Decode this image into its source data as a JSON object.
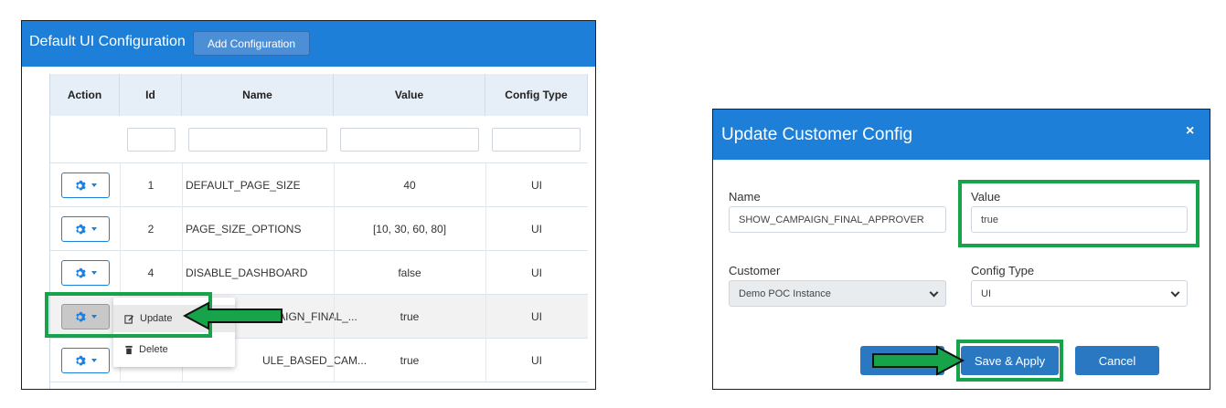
{
  "left": {
    "title": "Default UI Configuration",
    "add_button": "Add Configuration",
    "columns": [
      "Action",
      "Id",
      "Name",
      "Value",
      "Config Type"
    ],
    "rows": [
      {
        "id": "1",
        "name": "DEFAULT_PAGE_SIZE",
        "value": "40",
        "type": "UI"
      },
      {
        "id": "2",
        "name": "PAGE_SIZE_OPTIONS",
        "value": "[10, 30, 60, 80]",
        "type": "UI"
      },
      {
        "id": "4",
        "name": "DISABLE_DASHBOARD",
        "value": "false",
        "type": "UI"
      },
      {
        "id": "",
        "name": "MPAIGN_FINAL_...",
        "value": "true",
        "type": "UI"
      },
      {
        "id": "",
        "name": "ULE_BASED_CAM...",
        "value": "true",
        "type": "UI"
      }
    ],
    "dropdown": {
      "update": "Update",
      "delete": "Delete"
    }
  },
  "right": {
    "title": "Update Customer Config",
    "close": "×",
    "name_label": "Name",
    "name_value": "SHOW_CAMPAIGN_FINAL_APPROVER",
    "value_label": "Value",
    "value_value": "true",
    "customer_label": "Customer",
    "customer_value": "Demo POC Instance",
    "config_type_label": "Config Type",
    "config_type_value": "UI",
    "save_button": "Save & Apply",
    "cancel_button": "Cancel"
  },
  "colors": {
    "accent": "#1e7fd8",
    "highlight": "#16a34a"
  }
}
